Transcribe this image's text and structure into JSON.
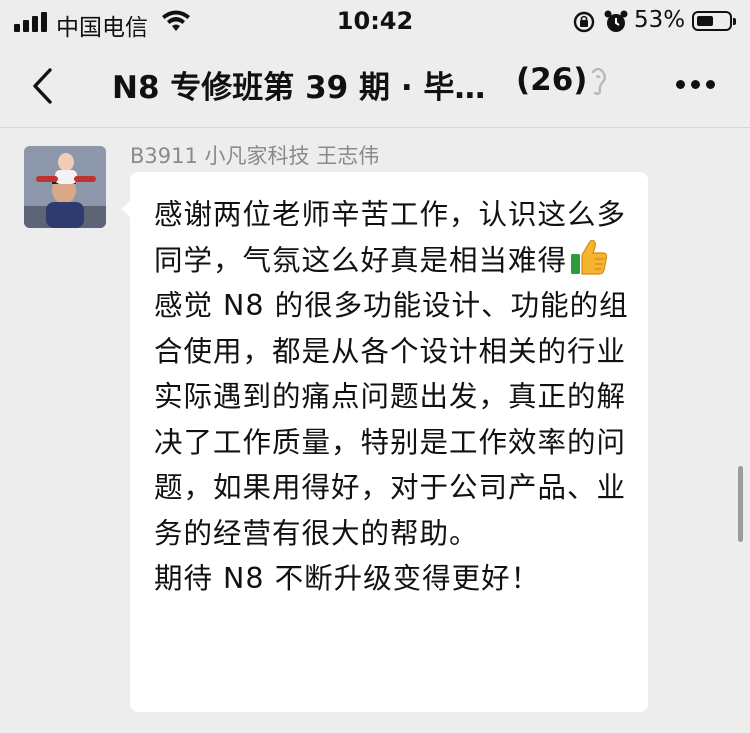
{
  "status_bar": {
    "carrier": "中国电信",
    "time": "10:42",
    "battery_percent": "53%",
    "battery_level": 0.53,
    "icons": [
      "signal-icon",
      "wifi-icon",
      "rotation-lock-icon",
      "alarm-icon",
      "battery-icon"
    ]
  },
  "nav": {
    "title": "N8 专修班第 39 期 · 毕…",
    "member_count": "(26)",
    "icons": [
      "back-icon",
      "mute-icon",
      "more-icon"
    ]
  },
  "message": {
    "sender": "B3911 小凡家科技 王志伟",
    "text_part1": "感谢两位老师辛苦工作，认识这么多同学，气氛这么好真是相当难得",
    "emoji": "thumbs-up-icon",
    "text_part2": "\n感觉 N8 的很多功能设计、功能的组合使用，都是从各个设计相关的行业实际遇到的痛点问题出发，真正的解决了工作质量，特别是工作效率的问题，如果用得好，对于公司产品、业务的经营有很大的帮助。\n期待 N8 不断升级变得更好！"
  }
}
